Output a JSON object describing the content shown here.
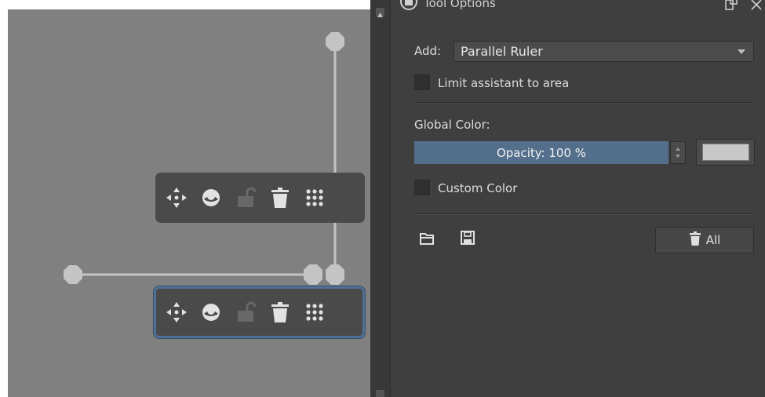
{
  "panel": {
    "title": "Tool Options",
    "add_label": "Add:",
    "add_value": "Parallel Ruler",
    "limit_label": "Limit assistant to area",
    "limit_checked": false,
    "global_color_label": "Global Color:",
    "opacity_text": "Opacity: 100 %",
    "opacity_value": 100,
    "swatch_color": "#c8c8c8",
    "custom_color_label": "Custom Color",
    "custom_color_checked": false,
    "delete_all_label": "All"
  },
  "canvas": {
    "background": "#808080",
    "guide_color": "#c4c4c4",
    "toolbox_buttons": [
      "move-icon",
      "eye-icon",
      "lock-icon",
      "trash-icon",
      "grid-dots-icon"
    ]
  },
  "colors": {
    "panel_bg": "#3f3f3f",
    "accent": "#536f8c",
    "active_border": "#4f7196"
  }
}
